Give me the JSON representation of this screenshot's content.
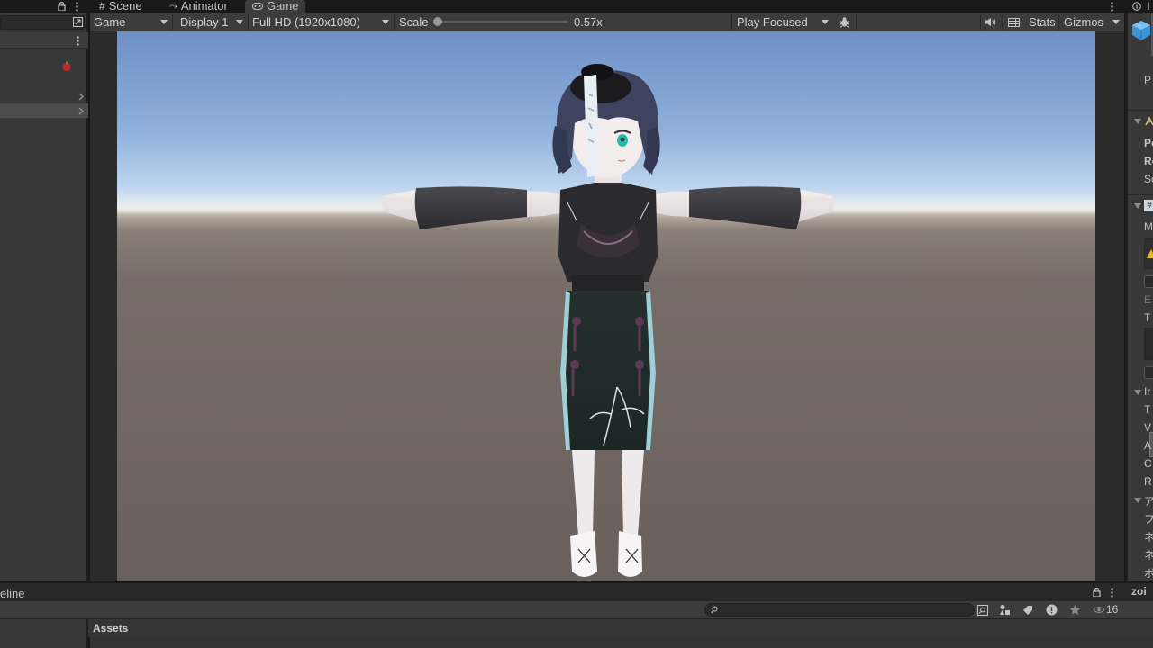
{
  "tabs": {
    "scene": "Scene",
    "animator": "Animator",
    "game": "Game"
  },
  "game_toolbar": {
    "view_mode": "Game",
    "display": "Display 1",
    "resolution": "Full HD (1920x1080)",
    "scale_label": "Scale",
    "scale_value": "0.57x",
    "scale_fraction": 0.0,
    "play_mode": "Play Focused",
    "stats": "Stats",
    "gizmos": "Gizmos"
  },
  "bottom_panel": {
    "tab_label_fragment": "eline",
    "breadcrumb": "Assets",
    "hidden_count": "16"
  },
  "inspector_fragments": {
    "f1": "P",
    "f2": "Po",
    "f3": "Ro",
    "f4": "Sc",
    "f5": "M",
    "f6": "E",
    "f7": "T",
    "f8": "Ir",
    "f9": "T",
    "f10": "V",
    "f11": "A",
    "f12": "C",
    "f13": "R",
    "f14": "ア",
    "f15": "フ",
    "f16": "ネ",
    "f17": "ネ",
    "f18": "ボ",
    "f19": "zoi"
  },
  "icons": {
    "lock": "lock-icon",
    "more": "kebab-menu-icon",
    "mute": "speaker-icon",
    "stats": "grid-icon",
    "bug": "bug-icon"
  },
  "colors": {
    "panel": "#383838",
    "toolbar": "#3c3c3c",
    "dark": "#191919",
    "sky_top": "#6e90c4",
    "ground": "#6a605c"
  }
}
